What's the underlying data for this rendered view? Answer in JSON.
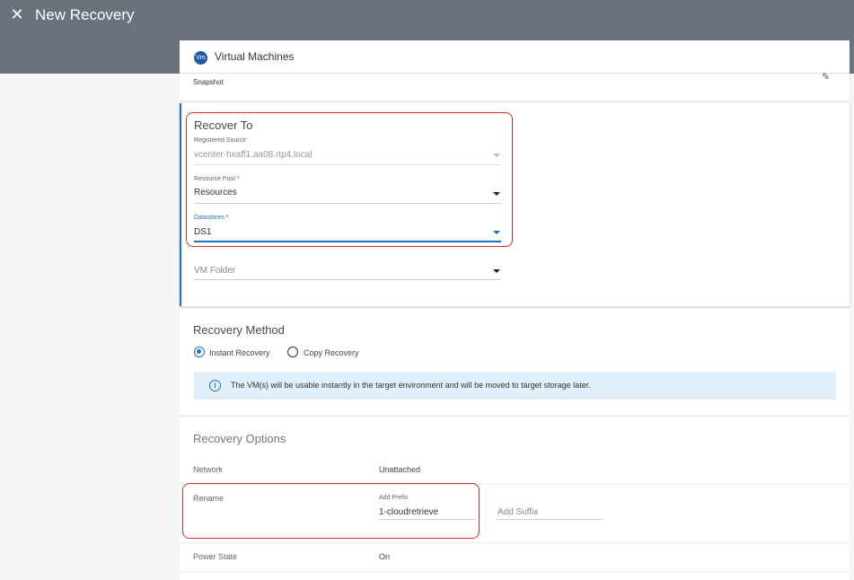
{
  "header": {
    "title": "New Recovery",
    "close_icon": "close-icon"
  },
  "vm_section": {
    "badge": "Vm",
    "title": "Virtual Machines",
    "snapshot_label": "Snapshot"
  },
  "recover_to": {
    "heading": "Recover To",
    "registered_source": {
      "label": "Registered Source",
      "value": "vcenter-hxaff1.aa08.rtp4.local"
    },
    "resource_pool": {
      "label": "Resource Pool *",
      "value": "Resources"
    },
    "datastores": {
      "label": "Datastores *",
      "value": "DS1"
    },
    "vm_folder": {
      "placeholder": "VM Folder"
    }
  },
  "recovery_method": {
    "heading": "Recovery Method",
    "options": [
      {
        "label": "Instant Recovery",
        "selected": true
      },
      {
        "label": "Copy Recovery",
        "selected": false
      }
    ],
    "info": "The VM(s) will be usable instantly in the target environment and will be moved to target storage later."
  },
  "recovery_options": {
    "heading": "Recovery Options",
    "network": {
      "label": "Network",
      "value": "Unattached"
    },
    "rename": {
      "label": "Rename",
      "prefix_label": "Add Prefix",
      "prefix_value": "1-cloudretrieve",
      "suffix_placeholder": "Add Suffix"
    },
    "power_state": {
      "label": "Power State",
      "value": "On"
    }
  },
  "colors": {
    "header_bg": "#6a737c",
    "accent": "#1f71c4",
    "highlight": "#d93025",
    "info_bg": "#e1f0fa"
  }
}
